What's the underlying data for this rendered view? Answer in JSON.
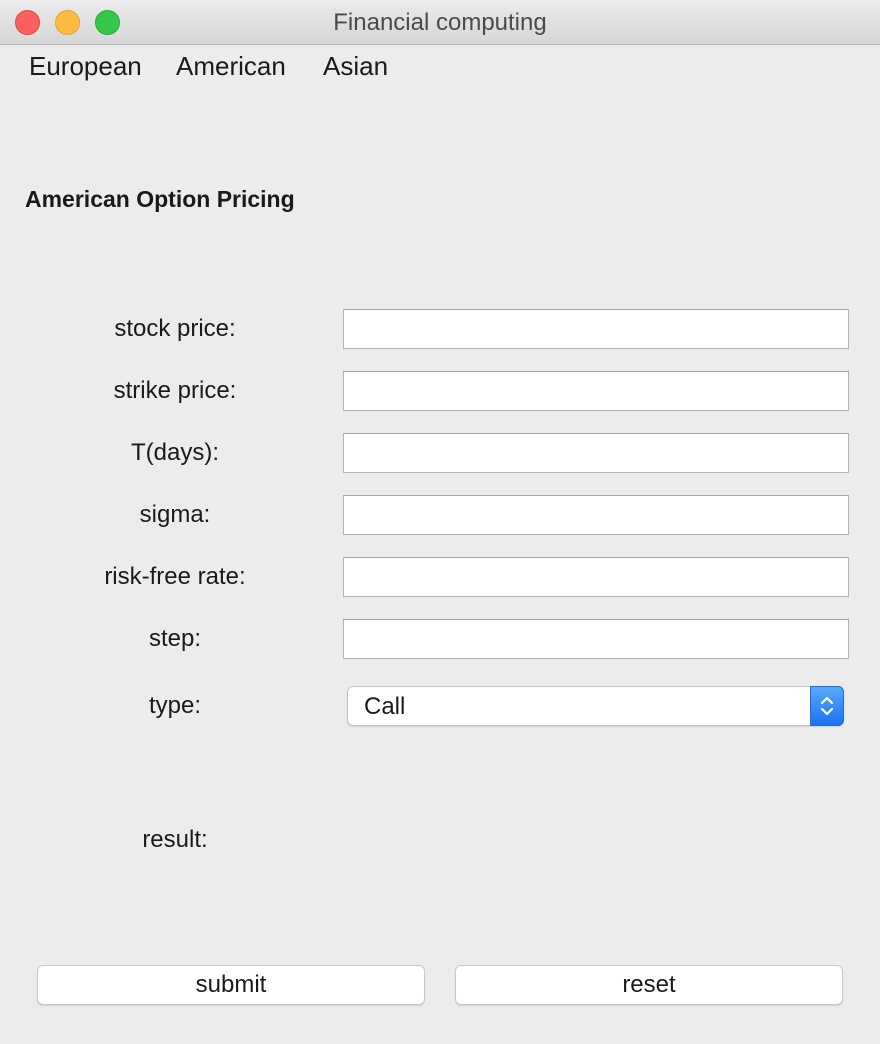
{
  "window": {
    "title": "Financial computing"
  },
  "menu": {
    "items": [
      {
        "label": "European"
      },
      {
        "label": "American"
      },
      {
        "label": "Asian"
      }
    ]
  },
  "form": {
    "heading": "American Option Pricing",
    "fields": [
      {
        "label": "stock price:",
        "value": ""
      },
      {
        "label": "strike price:",
        "value": ""
      },
      {
        "label": "T(days):",
        "value": ""
      },
      {
        "label": "sigma:",
        "value": ""
      },
      {
        "label": "risk-free rate:",
        "value": ""
      },
      {
        "label": "step:",
        "value": ""
      }
    ],
    "type": {
      "label": "type:",
      "selected": "Call"
    },
    "result": {
      "label": "result:",
      "value": ""
    }
  },
  "buttons": {
    "submit": "submit",
    "reset": "reset"
  },
  "colors": {
    "window_bg": "#ececec",
    "accent": "#1a73f0",
    "close": "#fc605c",
    "minimize": "#fdbc40",
    "maximize": "#34c84a"
  }
}
